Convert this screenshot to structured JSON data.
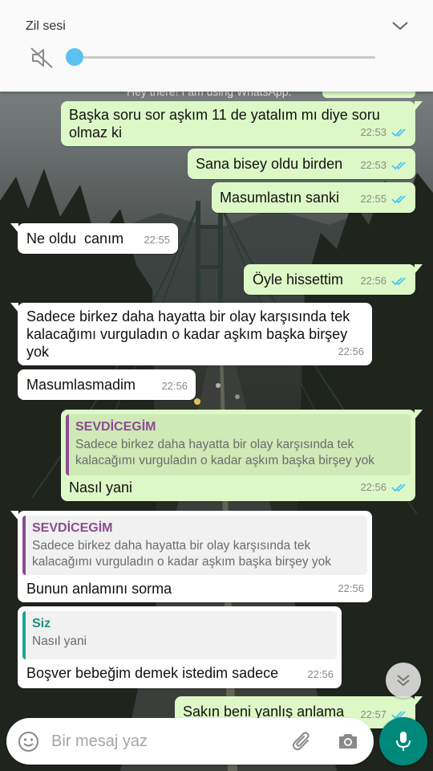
{
  "volume_panel": {
    "title": "Zil sesi",
    "level": 0
  },
  "status_peek": "Hey there! I am using WhatsApp.",
  "messages": [
    {
      "dir": "out",
      "text": "Başka soru sor aşkım 11 de yatalım mı diye soru\nolmaz ki",
      "time": "22:53",
      "read": true
    },
    {
      "dir": "out",
      "text": "Sana bisey oldu birden",
      "time": "22:53",
      "read": true
    },
    {
      "dir": "out",
      "text": "Masumlastın sanki",
      "time": "22:55",
      "read": true
    },
    {
      "dir": "in",
      "text": "Ne oldu  canım",
      "time": "22:55"
    },
    {
      "dir": "out",
      "text": "Öyle hissettim",
      "time": "22:56",
      "read": true
    },
    {
      "dir": "in",
      "text": "Sadece birkez daha hayatta bir olay karşısında tek\nkalacağımı vurguladın o kadar aşkım başka birşey\nyok",
      "time": "22:56"
    },
    {
      "dir": "in",
      "text": "Masumlasmadim",
      "time": "22:56"
    },
    {
      "dir": "out",
      "quote": {
        "author": "SEVDİCEGİM",
        "text": "Sadece birkez daha hayatta bir olay karşısında tek\nkalacağımı vurguladın o kadar aşkım başka birşey yok"
      },
      "text": "Nasıl yani",
      "time": "22:56",
      "read": true
    },
    {
      "dir": "in",
      "quote": {
        "author": "SEVDİCEGİM",
        "text": "Sadece birkez daha hayatta bir olay karşısında tek\nkalacağımı vurguladın o kadar aşkım başka birşey yok"
      },
      "text": "Bunun anlamını sorma",
      "time": "22:56"
    },
    {
      "dir": "in",
      "quote": {
        "author": "Siz",
        "text": "Nasıl yani"
      },
      "text": "Boşver bebeğim demek istedim sadece",
      "time": "22:56"
    },
    {
      "dir": "out",
      "text": "Sakın beni yanlış anlama",
      "time": "22:57",
      "read": true
    }
  ],
  "input": {
    "placeholder": "Bir mesaj yaz"
  },
  "icons": [
    "mute-icon",
    "chevron-down-icon",
    "double-check-icon",
    "emoji-icon",
    "attach-icon",
    "camera-icon",
    "mic-icon",
    "scroll-down-icon"
  ],
  "colors": {
    "outgoing_bubble": "#dcf8c6",
    "incoming_bubble": "#ffffff",
    "read_ticks": "#4fc3f7",
    "accent": "#00897b",
    "quote_purple": "#8e4a93",
    "quote_teal": "#1ea496",
    "volume_thumb": "#5bc0f2"
  }
}
